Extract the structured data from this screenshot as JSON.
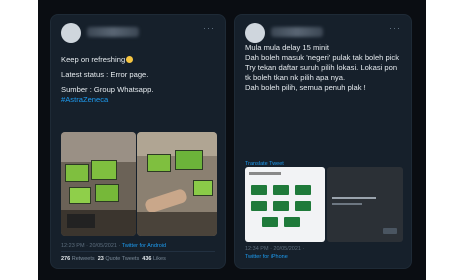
{
  "left_tweet": {
    "lines": [
      "Keep on refreshing",
      "Latest status : Error page.",
      "Sumber : Group Whatsapp."
    ],
    "hashtag": "#AstraZeneca",
    "meta_time": "12:23 PM · 20/05/2021 ·",
    "meta_client": "Twitter for Android",
    "retweets_count": "276",
    "retweets_label": "Retweets",
    "quotes_count": "23",
    "quotes_label": "Quote Tweets",
    "likes_count": "436",
    "likes_label": "Likes"
  },
  "right_tweet": {
    "lines": [
      "Mula mula delay 15 minit",
      "Dah boleh masuk 'negeri' pulak tak boleh pick",
      "Try tekan daftar suruh pilih lokasi. Lokasi pon tk boleh tkan nk pilih apa nya.",
      "Dah boleh pilih, semua penuh plak !"
    ],
    "embed_label": "Translate Tweet",
    "meta_time": "12:34 PM · 20/05/2021 ·",
    "meta_client": "Twitter for iPhone"
  },
  "icons": {
    "more": "more-dots-icon"
  }
}
